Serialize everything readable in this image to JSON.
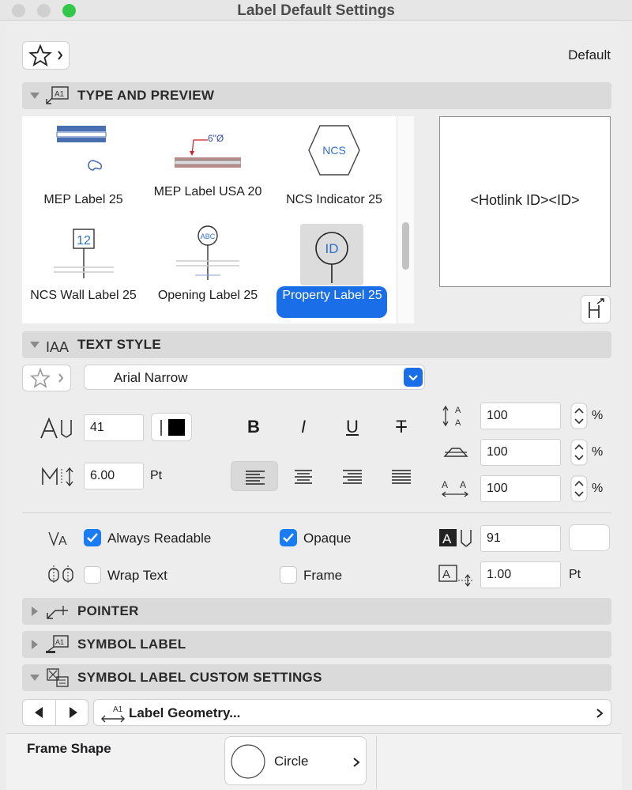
{
  "window": {
    "title": "Label Default Settings"
  },
  "top": {
    "favorites_icon": "star-icon",
    "default_label": "Default"
  },
  "sections": {
    "type_preview": "TYPE AND PREVIEW",
    "text_style": "TEXT STYLE",
    "pointer": "POINTER",
    "symbol_label": "SYMBOL LABEL",
    "custom_settings": "SYMBOL LABEL CUSTOM SETTINGS"
  },
  "labels": [
    {
      "name": "MEP Label 25",
      "selected": false
    },
    {
      "name": "MEP Label USA 20",
      "selected": false
    },
    {
      "name": "NCS Indicator 25",
      "selected": false
    },
    {
      "name": "NCS Wall Label 25",
      "selected": false
    },
    {
      "name": "Opening Label 25",
      "selected": false
    },
    {
      "name": "Property Label 25",
      "selected": true
    }
  ],
  "thumbs": {
    "ncs": "NCS",
    "wall_num": "12",
    "opening_abc": "ABC",
    "prop_id": "ID",
    "dim": "6\"Ø"
  },
  "preview": {
    "text": "<Hotlink ID><ID>"
  },
  "text_style": {
    "font": "Arial Narrow",
    "size": "41",
    "spacing": "6.00",
    "spacing_unit": "Pt",
    "width_pct": "100",
    "slant_pct": "100",
    "char_spacing_pct": "100",
    "pct": "%",
    "bold": "B",
    "italic": "I",
    "underline": "U",
    "strike": "T"
  },
  "options": {
    "always_readable": {
      "label": "Always Readable",
      "checked": true
    },
    "opaque": {
      "label": "Opaque",
      "checked": true
    },
    "wrap_text": {
      "label": "Wrap Text",
      "checked": false
    },
    "frame": {
      "label": "Frame",
      "checked": false
    },
    "fill_pen": "91",
    "frame_width": "1.00",
    "frame_unit": "Pt"
  },
  "custom": {
    "page_select": "Label Geometry...",
    "frame_shape_label": "Frame Shape",
    "frame_shape_value": "Circle"
  },
  "colors": {
    "accent": "#1a7cf5",
    "selected_tile": "#dcdcdc",
    "section_bg": "#dadada"
  }
}
